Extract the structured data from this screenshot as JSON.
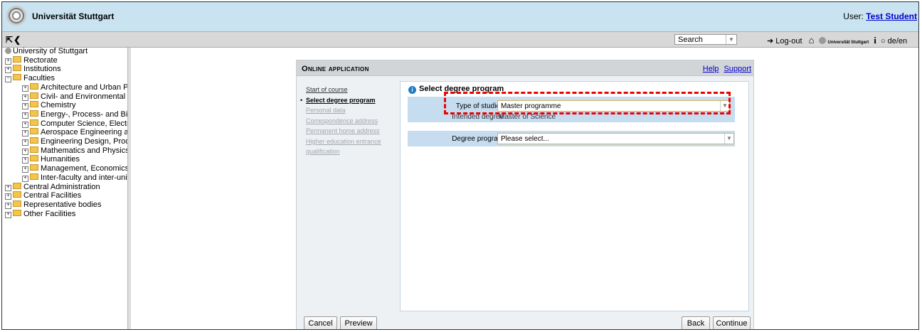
{
  "header": {
    "brand": "Universität Stuttgart",
    "user_prefix": "User:",
    "user_name": "Test Student"
  },
  "toolbar": {
    "search_value": "Search",
    "logout": "Log-out",
    "lang": "de/en",
    "mini_brand": "Universität Stuttgart"
  },
  "tree": {
    "root": "University of Stuttgart",
    "nodes": [
      {
        "label": "Rectorate",
        "sign": "+",
        "level": 1
      },
      {
        "label": "Institutions",
        "sign": "+",
        "level": 1
      },
      {
        "label": "Faculties",
        "sign": "-",
        "level": 1
      },
      {
        "label": "Architecture and Urban Pla",
        "sign": "+",
        "level": 2
      },
      {
        "label": "Civil- and Environmental Er",
        "sign": "+",
        "level": 2
      },
      {
        "label": "Chemistry",
        "sign": "+",
        "level": 2
      },
      {
        "label": "Energy-, Process- and Bio-",
        "sign": "+",
        "level": 2
      },
      {
        "label": "Computer Science, Electric",
        "sign": "+",
        "level": 2
      },
      {
        "label": "Aerospace Engineering anc",
        "sign": "+",
        "level": 2
      },
      {
        "label": "Engineering Design, Produ",
        "sign": "+",
        "level": 2
      },
      {
        "label": "Mathematics and Physics",
        "sign": "+",
        "level": 2
      },
      {
        "label": "Humanities",
        "sign": "+",
        "level": 2
      },
      {
        "label": "Management, Economics a",
        "sign": "+",
        "level": 2
      },
      {
        "label": "Inter-faculty and inter-unive",
        "sign": "+",
        "level": 2
      },
      {
        "label": "Central Administration",
        "sign": "+",
        "level": 1
      },
      {
        "label": "Central Facilities",
        "sign": "+",
        "level": 1
      },
      {
        "label": "Representative bodies",
        "sign": "+",
        "level": 1
      },
      {
        "label": "Other Facilities",
        "sign": "+",
        "level": 1
      }
    ]
  },
  "panel": {
    "title": "Online application",
    "help": "Help",
    "support": "Support",
    "steps": [
      {
        "label": "Start of course",
        "state": "link"
      },
      {
        "label": "Select degree program",
        "state": "current"
      },
      {
        "label": "Personal data",
        "state": "disabled"
      },
      {
        "label": "Correspondence address",
        "state": "disabled"
      },
      {
        "label": "Permanent home address",
        "state": "disabled"
      },
      {
        "label": "Higher education entrance qualification",
        "state": "disabled"
      }
    ],
    "section_title": "Select degree program",
    "type_label": "Type of studies",
    "type_value": "Master programme",
    "intended_label": "Intended degree",
    "intended_value": "Master of Science",
    "program_label": "Degree program",
    "program_value": "Please select...",
    "cancel": "Cancel",
    "preview": "Preview",
    "back": "Back",
    "continue": "Continue"
  },
  "colors": {
    "header_bg": "#c9e4f0",
    "link": "#0000cc",
    "highlight": "#ee0000",
    "field_row": "#c6dcef"
  }
}
